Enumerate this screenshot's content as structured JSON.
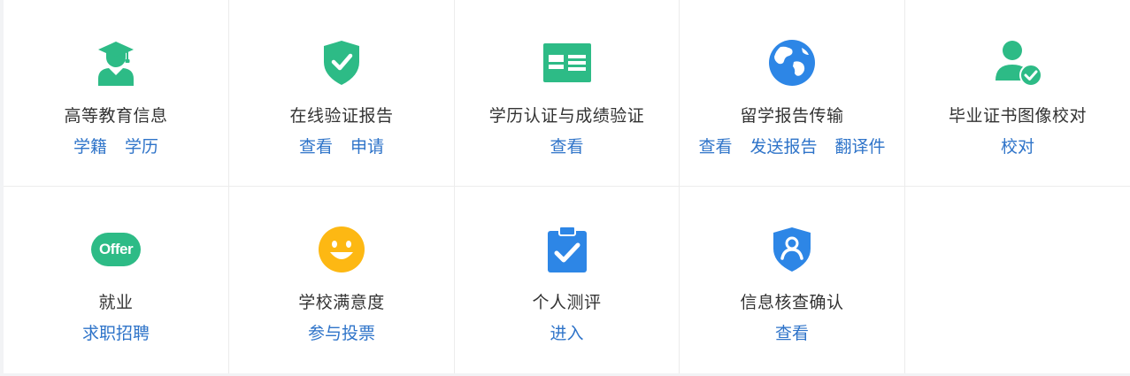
{
  "services": [
    {
      "title": "高等教育信息",
      "icon": "graduate-icon",
      "links": [
        "学籍",
        "学历"
      ]
    },
    {
      "title": "在线验证报告",
      "icon": "shield-check-icon",
      "links": [
        "查看",
        "申请"
      ]
    },
    {
      "title": "学历认证与成绩验证",
      "icon": "id-card-icon",
      "links": [
        "查看"
      ]
    },
    {
      "title": "留学报告传输",
      "icon": "globe-icon",
      "links": [
        "查看",
        "发送报告",
        "翻译件"
      ]
    },
    {
      "title": "毕业证书图像校对",
      "icon": "user-check-icon",
      "links": [
        "校对"
      ]
    },
    {
      "title": "就业",
      "icon": "offer-icon",
      "icon_text": "Offer",
      "links": [
        "求职招聘"
      ]
    },
    {
      "title": "学校满意度",
      "icon": "smiley-icon",
      "links": [
        "参与投票"
      ]
    },
    {
      "title": "个人测评",
      "icon": "clipboard-check-icon",
      "links": [
        "进入"
      ]
    },
    {
      "title": "信息核查确认",
      "icon": "shield-user-icon",
      "links": [
        "查看"
      ]
    }
  ],
  "colors": {
    "green": "#2dbb86",
    "blue": "#2d86e6",
    "yellow": "#fdb813",
    "link": "#2f74c9",
    "title": "#333333"
  }
}
